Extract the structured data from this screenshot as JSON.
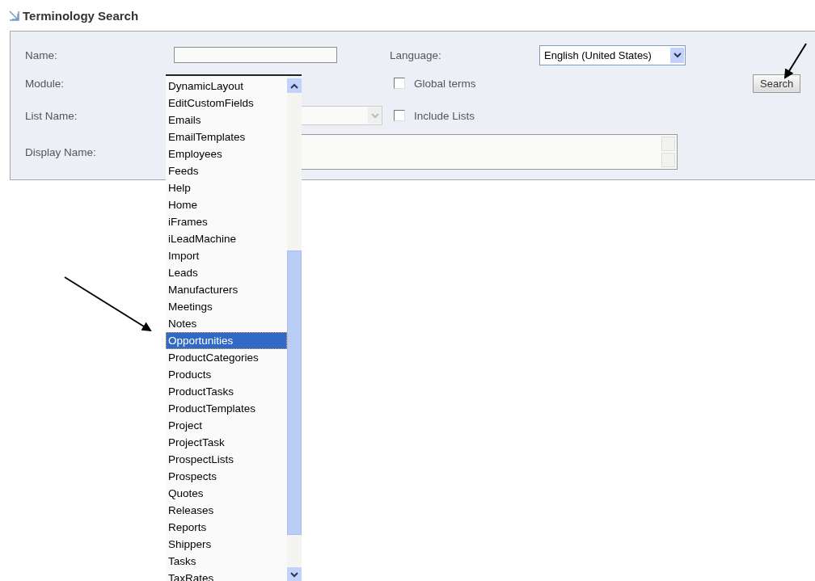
{
  "title": "Terminology Search",
  "form": {
    "name_label": "Name:",
    "module_label": "Module:",
    "list_name_label": "List Name:",
    "display_name_label": "Display Name:",
    "language_label": "Language:",
    "language_value": "English (United States)",
    "checkboxes": [
      {
        "label": "Global terms",
        "checked": false
      },
      {
        "label": "Include Lists",
        "checked": false
      }
    ],
    "search_button": "Search"
  },
  "module_dropdown": {
    "items": [
      {
        "label": "DynamicLayout",
        "selected": false
      },
      {
        "label": "EditCustomFields",
        "selected": false
      },
      {
        "label": "Emails",
        "selected": false
      },
      {
        "label": "EmailTemplates",
        "selected": false
      },
      {
        "label": "Employees",
        "selected": false
      },
      {
        "label": "Feeds",
        "selected": false
      },
      {
        "label": "Help",
        "selected": false
      },
      {
        "label": "Home",
        "selected": false
      },
      {
        "label": "iFrames",
        "selected": false
      },
      {
        "label": "iLeadMachine",
        "selected": false
      },
      {
        "label": "Import",
        "selected": false
      },
      {
        "label": "Leads",
        "selected": false
      },
      {
        "label": "Manufacturers",
        "selected": false
      },
      {
        "label": "Meetings",
        "selected": false
      },
      {
        "label": "Notes",
        "selected": false
      },
      {
        "label": "Opportunities",
        "selected": true
      },
      {
        "label": "ProductCategories",
        "selected": false
      },
      {
        "label": "Products",
        "selected": false
      },
      {
        "label": "ProductTasks",
        "selected": false
      },
      {
        "label": "ProductTemplates",
        "selected": false
      },
      {
        "label": "Project",
        "selected": false
      },
      {
        "label": "ProjectTask",
        "selected": false
      },
      {
        "label": "ProspectLists",
        "selected": false
      },
      {
        "label": "Prospects",
        "selected": false
      },
      {
        "label": "Quotes",
        "selected": false
      },
      {
        "label": "Releases",
        "selected": false
      },
      {
        "label": "Reports",
        "selected": false
      },
      {
        "label": "Shippers",
        "selected": false
      },
      {
        "label": "Tasks",
        "selected": false
      },
      {
        "label": "TaxRates",
        "selected": false
      }
    ]
  }
}
